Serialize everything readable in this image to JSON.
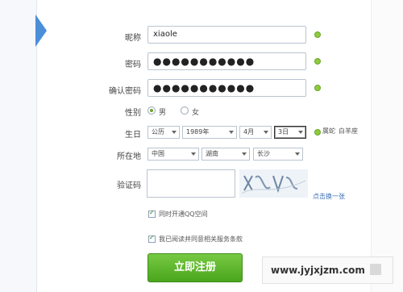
{
  "form": {
    "nickname": {
      "label": "昵称",
      "value": "xiaole"
    },
    "password": {
      "label": "密码",
      "value": "●●●●●●●●●●●"
    },
    "confirm_password": {
      "label": "确认密码",
      "value": "●●●●●●●●●●●"
    },
    "gender": {
      "label": "性别",
      "options": [
        "男",
        "女"
      ],
      "selected": "男"
    },
    "birthday": {
      "label": "生日",
      "calendar": "公历",
      "year": "1989年",
      "month": "4月",
      "day": "3日",
      "zodiac": "属蛇",
      "constellation": "白羊座"
    },
    "location": {
      "label": "所在地",
      "country": "中国",
      "province": "湖南",
      "city": "长沙"
    },
    "captcha": {
      "label": "验证码",
      "refresh_link": "点击换一张"
    },
    "checkbox_qq_space": "同时开通QQ空间",
    "checkbox_terms": "我已阅读并同意相关服务条款",
    "submit": "立即注册"
  },
  "watermark": {
    "text": "www.jyjxjzm.com"
  },
  "colors": {
    "green": "#4aa51d",
    "link": "#3a6fb5"
  }
}
